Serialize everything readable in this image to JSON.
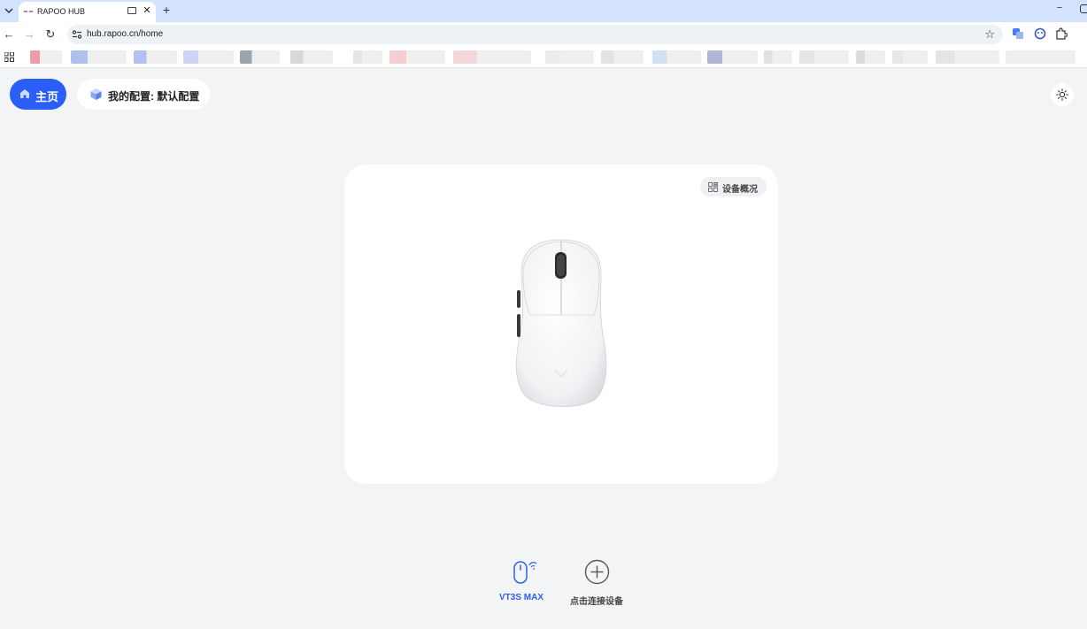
{
  "browser": {
    "tab": {
      "title": "RAPOO HUB",
      "close_glyph": "✕"
    },
    "new_tab_glyph": "+",
    "minimize_glyph": "−",
    "url": "hub.rapoo.cn/home",
    "nav": {
      "back_glyph": "←",
      "forward_glyph": "→",
      "reload_glyph": "↻"
    },
    "star_glyph": "☆",
    "icons": [
      "tab-search-icon",
      "rapoo-favicon-icon",
      "keyboard-icon",
      "site-info-icon",
      "translate-icon",
      "profile-icon",
      "extensions-icon",
      "apps-icon"
    ],
    "bookmark_colors": [
      "#ee8a98",
      "#9fb6e8",
      "#a9b2f0",
      "#c6cdf5",
      "#8b959c",
      "#d6cfcf",
      "#e6e0e0",
      "#f3c6c9",
      "#f0cfd2",
      "#e9e9e9",
      "#dedede",
      "#c9dcf3",
      "#a3a9cf",
      "#dcdcdc",
      "#e2e2e2",
      "#d5d5d5",
      "#e4e4e4",
      "#e0e0e0",
      "#ececec"
    ]
  },
  "header": {
    "home_label": "主页",
    "config_label": "我的配置: 默认配置",
    "icons": [
      "home-icon",
      "cube-icon",
      "sun-icon"
    ]
  },
  "device_card": {
    "overview_label": "设备概况",
    "image": "white-mouse-image"
  },
  "devices": {
    "current_label": "VT3S MAX",
    "connect_label": "点击连接设备"
  },
  "colors": {
    "accent": "#2b5ef7",
    "page_bg": "#f3f4f6",
    "card_bg": "#ffffff",
    "tabstrip_bg": "#d3e3fd"
  }
}
